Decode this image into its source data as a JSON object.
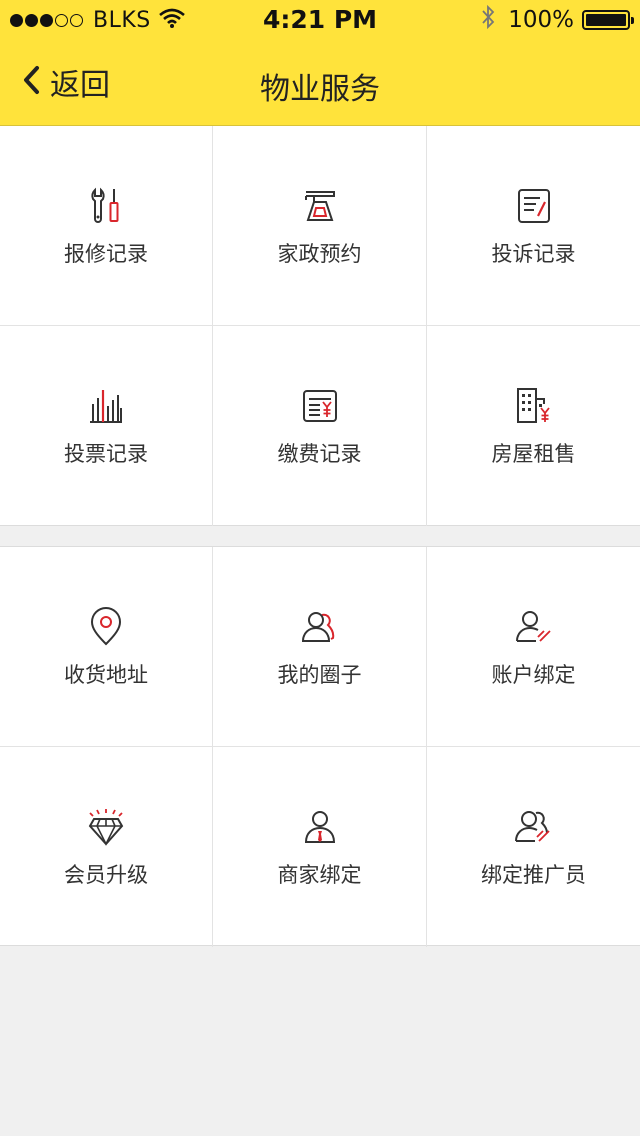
{
  "status_bar": {
    "carrier": "BLKS",
    "time": "4:21 PM",
    "battery": "100%"
  },
  "nav": {
    "back_label": "返回",
    "title": "物业服务"
  },
  "colors": {
    "header_bg": "#ffe33b",
    "accent_red": "#d9262c",
    "icon_dark": "#333333"
  },
  "sections": [
    {
      "items": [
        {
          "label": "报修记录",
          "icon": "repair-tools-icon"
        },
        {
          "label": "家政预约",
          "icon": "cleaning-icon"
        },
        {
          "label": "投诉记录",
          "icon": "complaint-note-icon"
        },
        {
          "label": "投票记录",
          "icon": "vote-chart-icon"
        },
        {
          "label": "缴费记录",
          "icon": "payment-bill-icon"
        },
        {
          "label": "房屋租售",
          "icon": "building-rent-icon"
        }
      ]
    },
    {
      "items": [
        {
          "label": "收货地址",
          "icon": "location-pin-icon"
        },
        {
          "label": "我的圈子",
          "icon": "friends-circle-icon"
        },
        {
          "label": "账户绑定",
          "icon": "account-bind-icon"
        },
        {
          "label": "会员升级",
          "icon": "diamond-icon"
        },
        {
          "label": "商家绑定",
          "icon": "merchant-user-icon"
        },
        {
          "label": "绑定推广员",
          "icon": "promoter-bind-icon"
        }
      ]
    }
  ]
}
